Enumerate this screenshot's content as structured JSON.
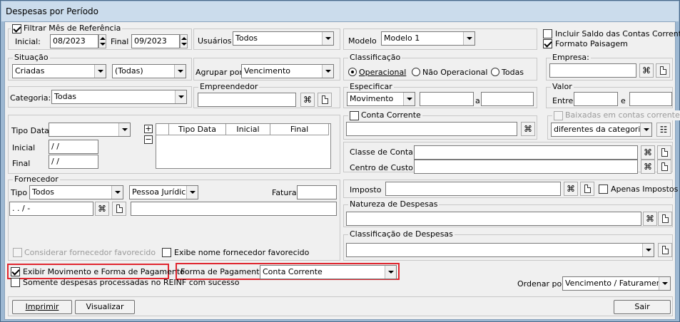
{
  "window": {
    "title": "Despesas por Período"
  },
  "filtrar": {
    "label": "Filtrar Mês de Referência",
    "inicial_label": "Inicial:",
    "inicial_value": "08/2023",
    "final_label": "Final",
    "final_value": "09/2023"
  },
  "usuarios": {
    "label": "Usuários",
    "value": "Todos"
  },
  "modelo": {
    "label": "Modelo",
    "value": "Modelo 1"
  },
  "options": {
    "incluir_saldo": "Incluir Saldo das Contas Correntes",
    "formato_paisagem": "Formato Paisagem"
  },
  "situacao": {
    "label": "Situação",
    "value1": "Criadas",
    "value2": "(Todas)"
  },
  "agrupar": {
    "label": "Agrupar por:",
    "value": "Vencimento"
  },
  "classificacao": {
    "label": "Classificação",
    "opt1": "Operacional",
    "opt2": "Não Operacional",
    "opt3": "Todas"
  },
  "empresa": {
    "label": "Empresa:"
  },
  "categoria": {
    "label": "Categoria:",
    "value": "Todas"
  },
  "empreendedor": {
    "label": "Empreendedor"
  },
  "especificar": {
    "label": "Especificar",
    "value": "Movimento",
    "a_label": "a"
  },
  "valor": {
    "label": "Valor",
    "entre_label": "Entre",
    "e_label": "e"
  },
  "tipodata": {
    "label": "Tipo Data:",
    "inicial_label": "Inicial",
    "inicial_value": "/ /",
    "final_label": "Final",
    "final_value": "/ /",
    "plus": "+",
    "minus": "−",
    "col1": "Tipo Data",
    "col2": "Inicial",
    "col3": "Final"
  },
  "conta_corrente": {
    "label": "Conta Corrente"
  },
  "baixadas": {
    "label": "Baixadas em contas correntes",
    "value": "diferentes da categoria de"
  },
  "classe_conta": {
    "label": "Classe de Conta"
  },
  "centro_custo": {
    "label": "Centro de Custo"
  },
  "fornecedor": {
    "label": "Fornecedor",
    "tipo_label": "Tipo",
    "tipo_value": "Todos",
    "pessoa_value": "Pessoa Jurídica",
    "fatura_label": "Fatura",
    "cnpj_value": ". . / -",
    "considerar": "Considerar fornecedor favorecido",
    "exibe_nome": "Exibe nome fornecedor favorecido"
  },
  "imposto": {
    "label": "Imposto",
    "apenas": "Apenas Impostos"
  },
  "natureza": {
    "label": "Natureza de Despesas"
  },
  "class_despesas": {
    "label": "Classificação de Despesas"
  },
  "exibir_mov": {
    "label": "Exibir Movimento e Forma de Pagamento"
  },
  "forma_pagamento": {
    "label": "Forma de Pagamento",
    "value": "Conta Corrente"
  },
  "reinf": {
    "label": "Somente despesas processadas no REINF com sucesso"
  },
  "ordenar": {
    "label": "Ordenar por:",
    "value": "Vencimento / Faturamento"
  },
  "buttons": {
    "imprimir": "Imprimir",
    "visualizar": "Visualizar",
    "sair": "Sair"
  },
  "icons": {
    "binoculars": "🔭",
    "new_doc": "new-document",
    "config": "settings"
  }
}
